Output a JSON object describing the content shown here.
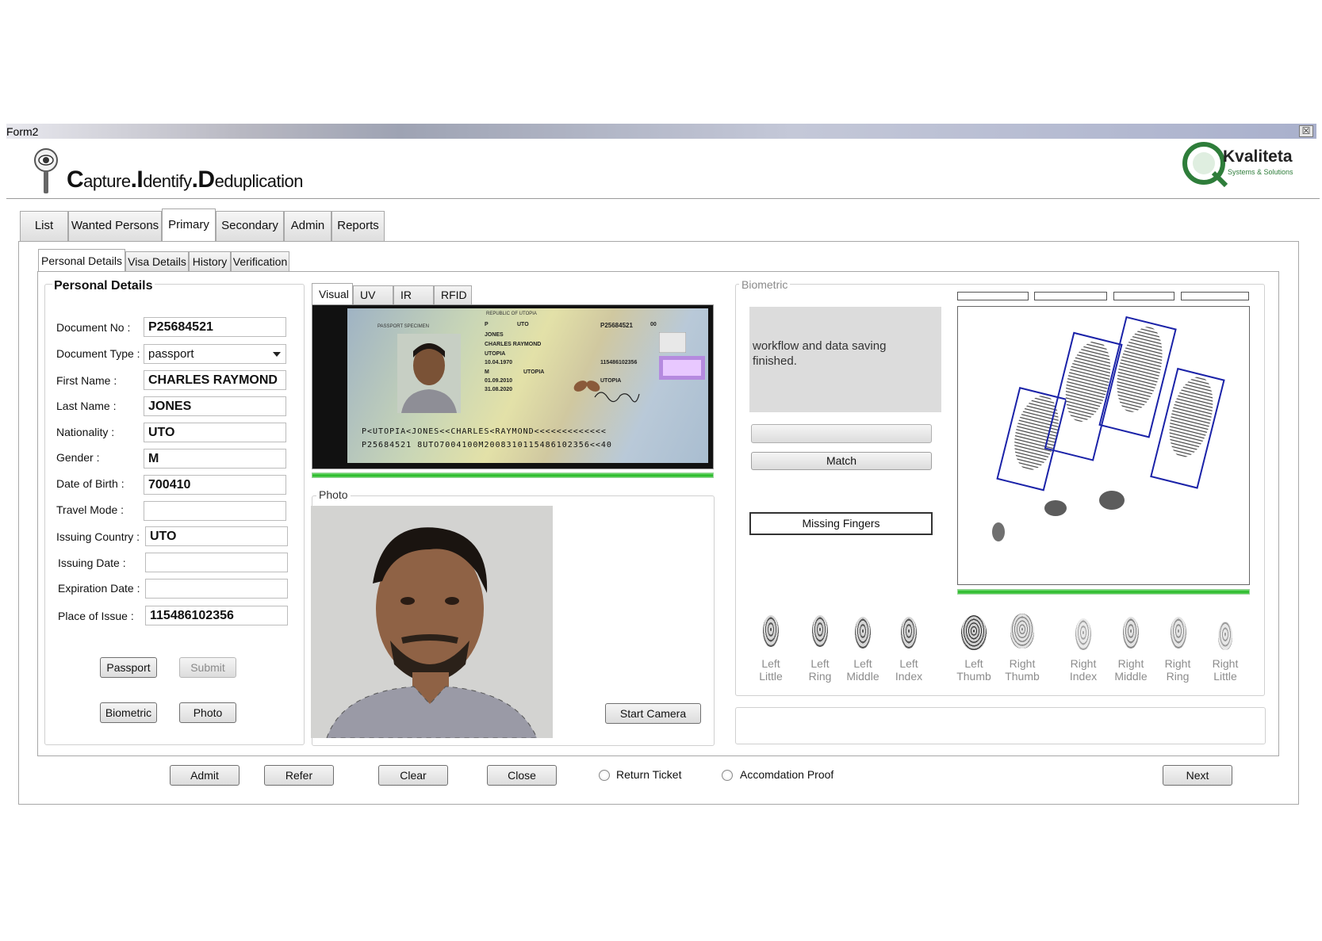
{
  "window": {
    "title": "Form2",
    "close_glyph": "☒"
  },
  "header": {
    "app_title": {
      "c": "C",
      "apture": "apture",
      "dot1": ".",
      "i": "I",
      "dentify": "dentify",
      "dot2": ".",
      "d": "D",
      "eduplication": "eduplication"
    },
    "logo": {
      "name": "Kvaliteta",
      "tagline": "Systems & Solutions"
    }
  },
  "main_tabs": [
    "List",
    "Wanted Persons",
    "Primary",
    "Secondary",
    "Admin",
    "Reports"
  ],
  "main_tab_active": "Primary",
  "sub_tabs": [
    "Personal Details",
    "Visa Details",
    "History",
    "Verification"
  ],
  "sub_tab_active": "Personal Details",
  "personal": {
    "heading": "Personal Details",
    "fields": [
      {
        "label": "Document No :",
        "value": "P25684521"
      },
      {
        "label": "Document Type :",
        "value": "passport"
      },
      {
        "label": "First Name :",
        "value": "CHARLES RAYMOND"
      },
      {
        "label": "Last Name :",
        "value": "JONES"
      },
      {
        "label": "Nationality :",
        "value": "UTO"
      },
      {
        "label": "Gender :",
        "value": "M"
      },
      {
        "label": "Date of Birth :",
        "value": "700410"
      },
      {
        "label": "Travel Mode :",
        "value": ""
      },
      {
        "label": "Issuing Country :",
        "value": "UTO"
      },
      {
        "label": "Issuing Date :",
        "value": ""
      },
      {
        "label": "Expiration Date :",
        "value": ""
      },
      {
        "label": "Place of Issue :",
        "value": "115486102356"
      }
    ],
    "buttons": {
      "passport": "Passport",
      "submit": "Submit",
      "biometric": "Biometric",
      "photo": "Photo"
    }
  },
  "document": {
    "tabs": [
      "Visual",
      "UV",
      "IR",
      "RFID"
    ],
    "active_tab": "Visual",
    "passport": {
      "country_header": "REPUBLIC OF UTOPIA",
      "specimen": "PASSPORT SPECIMEN",
      "type": "P",
      "code": "UTO",
      "number": "P25684521",
      "number_suffix": "00",
      "surname": "JONES",
      "given_names": "CHARLES RAYMOND",
      "nationality": "UTOPIA",
      "dob": "10.04.1970",
      "sex": "M",
      "place_of_birth": "UTOPIA",
      "issue_date": "01.09.2010",
      "expiry_date": "31.08.2020",
      "personal_no": "115486102356",
      "authority": "UTOPIA",
      "mrz1": "P<UTOPIA<JONES<<CHARLES<RAYMOND<<<<<<<<<<<<<",
      "mrz2": "P25684521 8UTO7004100M2008310115486102356<<40"
    },
    "progress": 1.0
  },
  "photo": {
    "group_label": "Photo",
    "start_camera": "Start Camera"
  },
  "biometric": {
    "group_label": "Biometric",
    "status_text": "workflow and data saving finished.",
    "match_button": "Match",
    "missing_fingers_button": "Missing Fingers",
    "progress": 1.0,
    "fingers": [
      {
        "line1": "Left",
        "line2": "Little"
      },
      {
        "line1": "Left",
        "line2": "Ring"
      },
      {
        "line1": "Left",
        "line2": "Middle"
      },
      {
        "line1": "Left",
        "line2": "Index"
      },
      {
        "line1": "Left",
        "line2": "Thumb"
      },
      {
        "line1": "Right",
        "line2": "Thumb"
      },
      {
        "line1": "Right",
        "line2": "Index"
      },
      {
        "line1": "Right",
        "line2": "Middle"
      },
      {
        "line1": "Right",
        "line2": "Ring"
      },
      {
        "line1": "Right",
        "line2": "Little"
      }
    ]
  },
  "bottom": {
    "admit": "Admit",
    "refer": "Refer",
    "clear": "Clear",
    "close": "Close",
    "return_ticket": "Return Ticket",
    "accommodation_proof": "Accomdation Proof",
    "next": "Next"
  },
  "colors": {
    "progress_green": "#22b522",
    "finger_box_blue": "#1a22a8",
    "logo_green": "#2e7d3a"
  }
}
